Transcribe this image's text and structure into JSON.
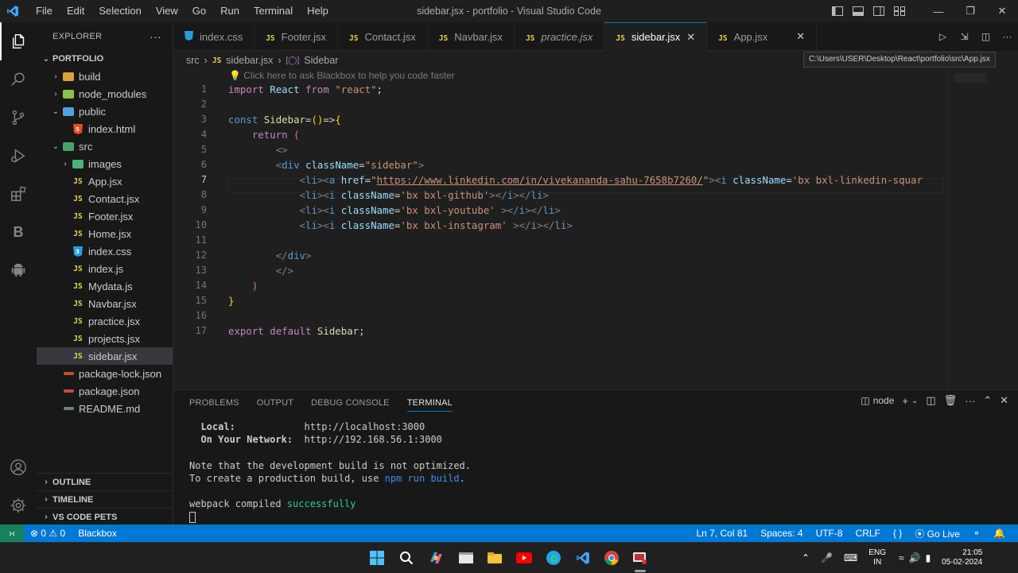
{
  "window": {
    "title": "sidebar.jsx - portfolio - Visual Studio Code",
    "menu": [
      "File",
      "Edit",
      "Selection",
      "View",
      "Go",
      "Run",
      "Terminal",
      "Help"
    ]
  },
  "explorer": {
    "header": "EXPLORER",
    "root": "PORTFOLIO",
    "items": [
      {
        "label": "build",
        "type": "folder",
        "depth": 1,
        "expanded": false
      },
      {
        "label": "node_modules",
        "type": "folder",
        "depth": 1,
        "expanded": false
      },
      {
        "label": "public",
        "type": "folder",
        "depth": 1,
        "expanded": true
      },
      {
        "label": "index.html",
        "type": "html",
        "depth": 2
      },
      {
        "label": "src",
        "type": "folder",
        "depth": 1,
        "expanded": true
      },
      {
        "label": "images",
        "type": "folder",
        "depth": 2,
        "expanded": false
      },
      {
        "label": "App.jsx",
        "type": "js",
        "depth": 2
      },
      {
        "label": "Contact.jsx",
        "type": "js",
        "depth": 2
      },
      {
        "label": "Footer.jsx",
        "type": "js",
        "depth": 2
      },
      {
        "label": "Home.jsx",
        "type": "js",
        "depth": 2
      },
      {
        "label": "index.css",
        "type": "css",
        "depth": 2
      },
      {
        "label": "index.js",
        "type": "js",
        "depth": 2
      },
      {
        "label": "Mydata.js",
        "type": "js",
        "depth": 2
      },
      {
        "label": "Navbar.jsx",
        "type": "js",
        "depth": 2
      },
      {
        "label": "practice.jsx",
        "type": "js",
        "depth": 2
      },
      {
        "label": "projects.jsx",
        "type": "js",
        "depth": 2
      },
      {
        "label": "sidebar.jsx",
        "type": "js",
        "depth": 2,
        "selected": true
      },
      {
        "label": "package-lock.json",
        "type": "json",
        "depth": 1
      },
      {
        "label": "package.json",
        "type": "json",
        "depth": 1
      },
      {
        "label": "README.md",
        "type": "md",
        "depth": 1
      }
    ],
    "sections": [
      "OUTLINE",
      "TIMELINE",
      "VS CODE PETS"
    ]
  },
  "tabs": [
    {
      "label": "index.css",
      "icon": "css"
    },
    {
      "label": "Footer.jsx",
      "icon": "js"
    },
    {
      "label": "Contact.jsx",
      "icon": "js"
    },
    {
      "label": "Navbar.jsx",
      "icon": "js"
    },
    {
      "label": "practice.jsx",
      "icon": "js",
      "italic": true
    },
    {
      "label": "sidebar.jsx",
      "icon": "js",
      "active": true
    },
    {
      "label": "App.jsx",
      "icon": "js"
    }
  ],
  "tooltip": "C:\\Users\\USER\\Desktop\\React\\portfolio\\src\\App.jsx",
  "breadcrumb": {
    "folder": "src",
    "file": "sidebar.jsx",
    "symbol": "Sidebar"
  },
  "editor": {
    "hint": "Click here to ask Blackbox to help you code faster",
    "current_line": 7,
    "line_numbers": [
      "1",
      "2",
      "3",
      "4",
      "5",
      "6",
      "7",
      "8",
      "9",
      "10",
      "11",
      "12",
      "13",
      "14",
      "15",
      "16",
      "17"
    ]
  },
  "panel": {
    "tabs": [
      "PROBLEMS",
      "OUTPUT",
      "DEBUG CONSOLE",
      "TERMINAL"
    ],
    "active_tab": "TERMINAL",
    "terminal_name": "node",
    "lines": {
      "local_label": "Local:",
      "local_url": "http://localhost:3000",
      "network_label": "On Your Network:",
      "network_url": "http://192.168.56.1:3000",
      "note": "Note that the development build is not optimized.",
      "create_prefix": "To create a production build, use ",
      "create_cmd": "npm run build",
      "create_suffix": ".",
      "webpack_prefix": "webpack compiled ",
      "webpack_status": "successfully"
    }
  },
  "statusbar": {
    "problems": "0",
    "warnings": "0",
    "blackbox": "Blackbox",
    "position": "Ln 7, Col 81",
    "spaces": "Spaces: 4",
    "encoding": "UTF-8",
    "eol": "CRLF",
    "lang": "{ }",
    "golive": "Go Live"
  },
  "taskbar": {
    "lang1": "ENG",
    "lang2": "IN",
    "time": "21:05",
    "date": "05-02-2024"
  }
}
